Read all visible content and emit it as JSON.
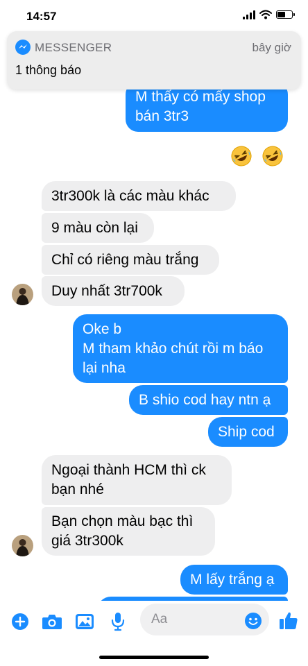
{
  "status_bar": {
    "time": "14:57"
  },
  "notification": {
    "app": "MESSENGER",
    "time": "bây giờ",
    "body": "1 thông báo"
  },
  "messages": {
    "m1": {
      "lines": [
        "M thấy có mấy shop",
        "bán 3tr3"
      ]
    },
    "m2": {
      "lines": [
        "3tr300k là các màu khác"
      ]
    },
    "m3": {
      "lines": [
        "9 màu còn lại"
      ]
    },
    "m4": {
      "lines": [
        "Chỉ có riêng màu trắng"
      ]
    },
    "m5": {
      "lines": [
        "Duy nhất 3tr700k"
      ]
    },
    "m6": {
      "lines": [
        "Oke b",
        "M tham khảo chút rồi m báo",
        "lại nha"
      ]
    },
    "m7": {
      "lines": [
        "B shio cod hay ntn ạ"
      ]
    },
    "m8": {
      "lines": [
        "Ship cod"
      ]
    },
    "m9": {
      "lines": [
        "Ngoại thành HCM thì ck",
        "bạn nhé"
      ]
    },
    "m10": {
      "lines": [
        "Bạn chọn màu bạc thì",
        "giá 3tr300k"
      ]
    },
    "m11": {
      "lines": [
        "M lấy trắng ạ"
      ]
    }
  },
  "reactions": {
    "emoji": "rolling-on-floor-laughing",
    "count": 2
  },
  "composer": {
    "placeholder": "Aa"
  },
  "colors": {
    "accent": "#1a8cff",
    "incoming_bubble": "#eeeeef"
  },
  "icons": [
    "plus-icon",
    "camera-icon",
    "image-icon",
    "microphone-icon",
    "emoji-icon",
    "thumbs-up-icon"
  ]
}
